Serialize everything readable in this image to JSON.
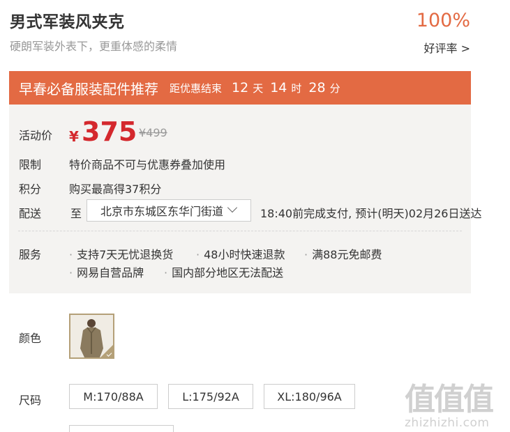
{
  "product": {
    "title": "男式军装风夹克",
    "subtitle": "硬朗军装外表下，更重体感的柔情"
  },
  "rating": {
    "percent": "100%",
    "link_label": "好评率 >"
  },
  "promo": {
    "title": "早春必备服装配件推荐",
    "countdown_label": "距优惠结束",
    "days": "12",
    "days_unit": "天",
    "hours": "14",
    "hours_unit": "时",
    "minutes": "28",
    "minutes_unit": "分"
  },
  "info": {
    "price_label": "活动价",
    "currency": "¥",
    "price": "375",
    "original_price": "¥499",
    "limit_label": "限制",
    "limit_text": "特价商品不可与优惠券叠加使用",
    "points_label": "积分",
    "points_text": "购买最高得37积分",
    "shipping_label": "配送",
    "shipping_to": "至",
    "address": "北京市东城区东华门街道",
    "shipping_note": "18:40前完成支付, 预计(明天)02月26日送达",
    "service_label": "服务",
    "services": [
      "支持7天无忧退换货",
      "48小时快速退款",
      "满88元免邮费",
      "网易自营品牌",
      "国内部分地区无法配送"
    ]
  },
  "options": {
    "color_label": "颜色",
    "size_label": "尺码",
    "sizes": [
      "M:170/88A",
      "L:175/92A",
      "XL:180/96A"
    ]
  },
  "watermark": {
    "glyphs": "值值值",
    "url": "zhizhizhi.com"
  },
  "colors": {
    "accent": "#e36a43",
    "price": "#d4282d",
    "panel_bg": "#f4f3f1",
    "swatch_border": "#b4a078"
  }
}
